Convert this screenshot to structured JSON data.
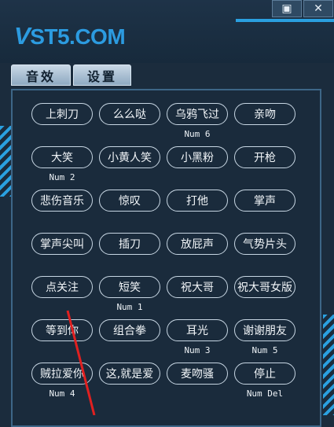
{
  "app": {
    "logo_v": "V",
    "logo_rest": "ST5.COM"
  },
  "window": {
    "minimize_glyph": "▣",
    "close_glyph": "✕"
  },
  "tabs": [
    {
      "label": "音效"
    },
    {
      "label": "设置"
    }
  ],
  "sounds": [
    {
      "label": "上刺刀",
      "key": ""
    },
    {
      "label": "么么哒",
      "key": ""
    },
    {
      "label": "乌鸦飞过",
      "key": "Num 6"
    },
    {
      "label": "亲吻",
      "key": ""
    },
    {
      "label": "大笑",
      "key": "Num 2"
    },
    {
      "label": "小黄人笑",
      "key": ""
    },
    {
      "label": "小黑粉",
      "key": ""
    },
    {
      "label": "开枪",
      "key": ""
    },
    {
      "label": "悲伤音乐",
      "key": ""
    },
    {
      "label": "惊叹",
      "key": ""
    },
    {
      "label": "打他",
      "key": ""
    },
    {
      "label": "掌声",
      "key": ""
    },
    {
      "label": "掌声尖叫",
      "key": ""
    },
    {
      "label": "插刀",
      "key": ""
    },
    {
      "label": "放屁声",
      "key": ""
    },
    {
      "label": "气势片头",
      "key": ""
    },
    {
      "label": "点关注",
      "key": ""
    },
    {
      "label": "短笑",
      "key": "Num 1"
    },
    {
      "label": "祝大哥",
      "key": ""
    },
    {
      "label": "祝大哥女版",
      "key": ""
    },
    {
      "label": "等到你",
      "key": ""
    },
    {
      "label": "组合拳",
      "key": ""
    },
    {
      "label": "耳光",
      "key": "Num 3"
    },
    {
      "label": "谢谢朋友",
      "key": "Num 5"
    },
    {
      "label": "贼拉爱你",
      "key": "Num 4"
    },
    {
      "label": "这,就是爱",
      "key": ""
    },
    {
      "label": "麦吻骚",
      "key": ""
    },
    {
      "label": "停止",
      "key": "Num Del"
    }
  ],
  "colors": {
    "accent": "#2aa0e0",
    "background": "#1b2c3d",
    "annotation_arrow": "#e02020"
  }
}
